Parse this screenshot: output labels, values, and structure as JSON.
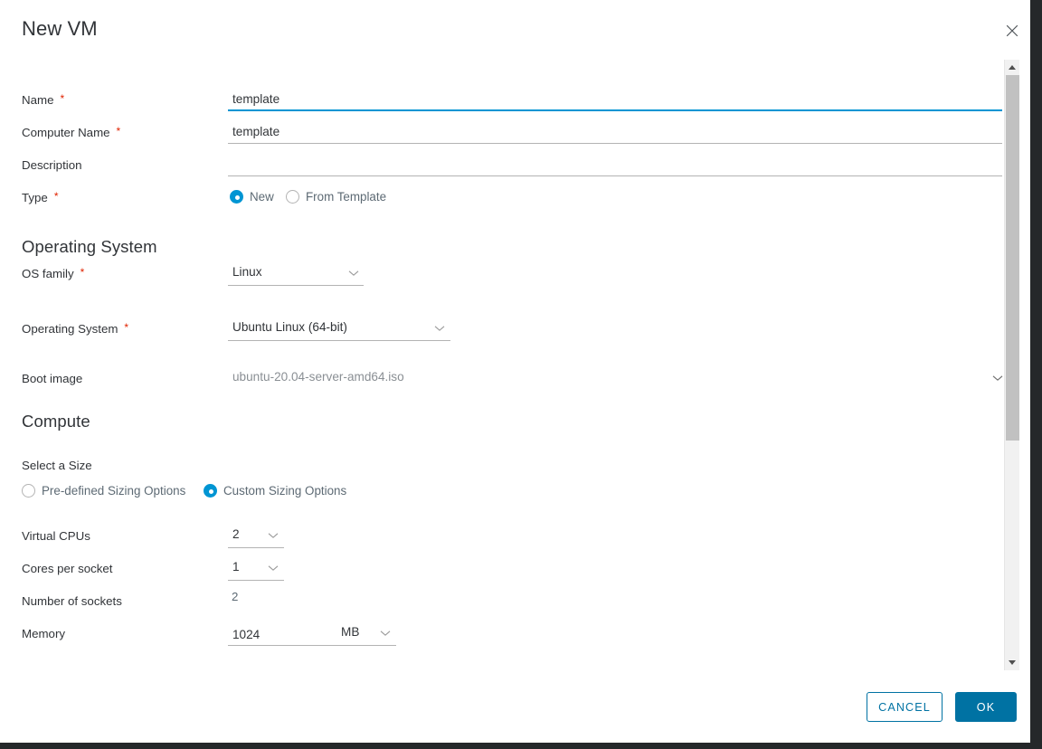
{
  "dialog": {
    "title": "New VM",
    "close_icon": "close-icon"
  },
  "form": {
    "fields": {
      "name": {
        "label": "Name",
        "required": "*",
        "value": "template",
        "placeholder": ""
      },
      "computer_name": {
        "label": "Computer Name",
        "required": "*",
        "value": "template",
        "placeholder": ""
      },
      "description": {
        "label": "Description",
        "value": "",
        "placeholder": ""
      },
      "type": {
        "label": "Type",
        "required": "*",
        "options": [
          {
            "label": "New",
            "selected": true
          },
          {
            "label": "From Template",
            "selected": false
          }
        ]
      }
    }
  },
  "operating_system": {
    "section_title": "Operating System",
    "os_family": {
      "label": "OS family",
      "required": "*",
      "value": "Linux"
    },
    "operating_system": {
      "label": "Operating System",
      "required": "*",
      "value": "Ubuntu Linux (64-bit)"
    },
    "boot_image": {
      "label": "Boot image",
      "value": "ubuntu-20.04-server-amd64.iso"
    }
  },
  "compute": {
    "section_title": "Compute",
    "select_a_size": {
      "label": "Select a Size",
      "options": [
        {
          "label": "Pre-defined Sizing Options",
          "selected": false
        },
        {
          "label": "Custom Sizing Options",
          "selected": true
        }
      ]
    },
    "virtual_cpus": {
      "label": "Virtual CPUs",
      "value": "2"
    },
    "cores_per_socket": {
      "label": "Cores per socket",
      "value": "1"
    },
    "number_of_sockets": {
      "label": "Number of sockets",
      "value": "2"
    },
    "memory": {
      "label": "Memory",
      "value": "1024",
      "unit": "MB"
    }
  },
  "footer": {
    "cancel_label": "CANCEL",
    "ok_label": "OK"
  },
  "colors": {
    "accent_blue": "#0095d3",
    "action_blue": "#0072a3",
    "required_red": "#e02200",
    "text": "#313438",
    "muted_text": "#5d6a74",
    "underline": "#b3b3b3",
    "chrome_dark": "#25282a"
  },
  "scrollbar": {
    "up_icon": "caret-up-icon",
    "down_icon": "caret-down-icon"
  }
}
